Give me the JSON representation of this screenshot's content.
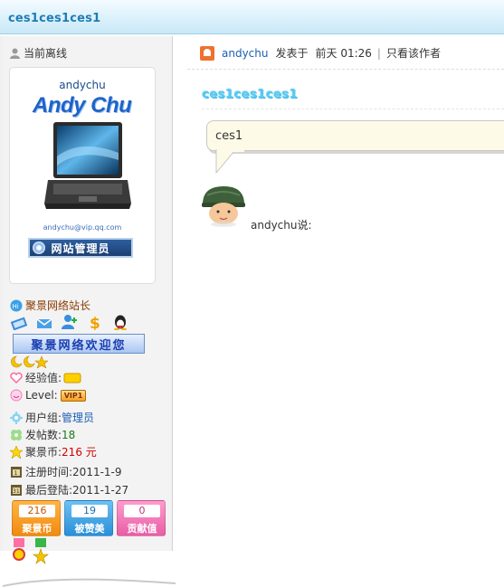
{
  "header": {
    "title": "ces1ces1ces1"
  },
  "sidebar": {
    "online_label": "当前离线",
    "avatar": {
      "username": "andychu",
      "logo_text": "Andy Chu",
      "email": "andychu@vip.qq.com",
      "badge": "网站管理员"
    },
    "title_label": "聚景网络站长",
    "welcome_banner": "聚景网络欢迎您",
    "rows": {
      "exp_label": "经验值:",
      "level_label": "Level:",
      "level_badge": "VIP1",
      "group_label": "用户组:",
      "group_value": "管理员",
      "posts_label": "发帖数:",
      "posts_value": "18",
      "coins_label": "聚景币:",
      "coins_value": "216 元",
      "regtime_label": "注册时间:",
      "regtime_value": "2011-1-9",
      "lastlogin_label": "最后登陆:",
      "lastlogin_value": "2011-1-27"
    },
    "stats": [
      {
        "value": "216",
        "label": "聚景币"
      },
      {
        "value": "19",
        "label": "被赞美"
      },
      {
        "value": "0",
        "label": "贡献值"
      }
    ]
  },
  "post": {
    "author": "andychu",
    "posted_label": "发表于",
    "time": "前天 01:26",
    "only_author": "只看该作者",
    "title": "ces1ces1ces1",
    "bubble_text": "ces1",
    "saying": "andychu说:"
  },
  "colors": {
    "accent": "#1f7cb5",
    "title_glow": "#5cc8ef",
    "coins": "#d40000",
    "posts": "#1a7a1a"
  }
}
